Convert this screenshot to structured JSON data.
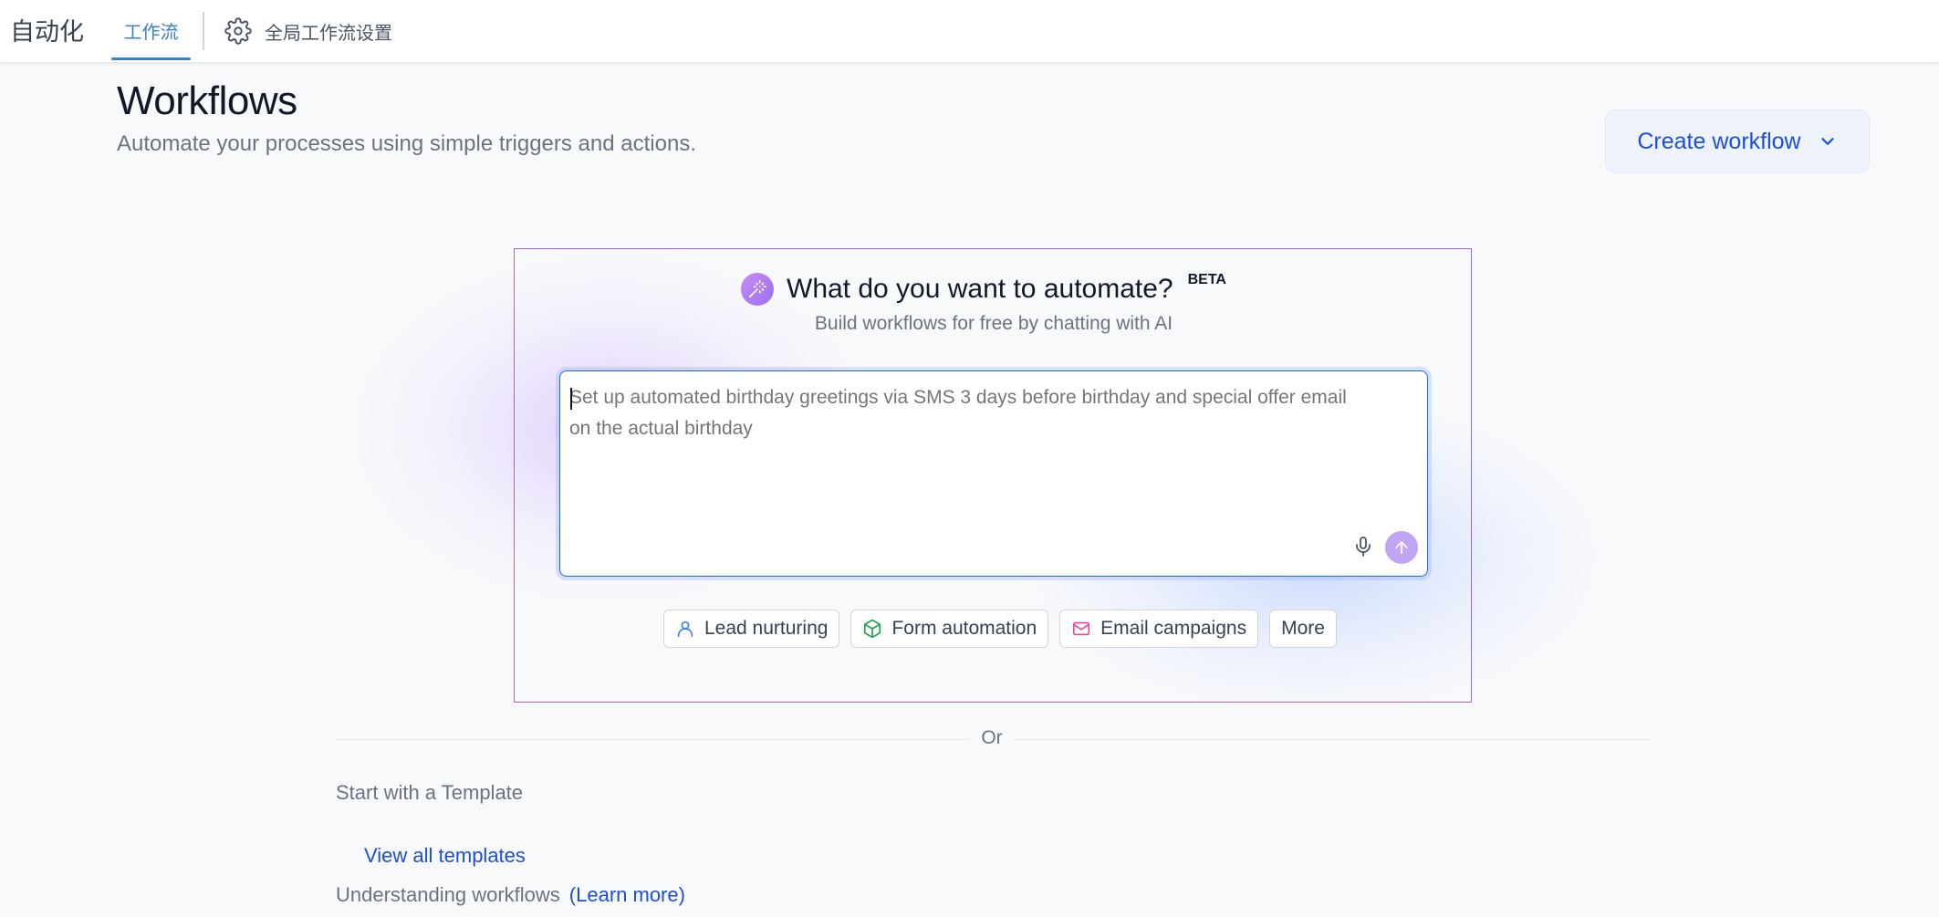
{
  "nav": {
    "app_title": "自动化",
    "tabs": [
      {
        "label": "工作流",
        "active": true
      },
      {
        "label": "全局工作流设置",
        "icon": "gear-icon"
      }
    ]
  },
  "header": {
    "title": "Workflows",
    "subtitle": "Automate your processes using simple triggers and actions.",
    "create_button": "Create workflow"
  },
  "ai": {
    "title": "What do you want to automate?",
    "badge": "BETA",
    "subtitle": "Build workflows for free by chatting with AI",
    "prompt_placeholder": "Set up automated birthday greetings via SMS 3 days before birthday and special offer email on the actual birthday",
    "chips": [
      {
        "label": "Lead nurturing",
        "icon": "user-icon",
        "color": "#3b82f6"
      },
      {
        "label": "Form automation",
        "icon": "cube-icon",
        "color": "#16a34a"
      },
      {
        "label": "Email campaigns",
        "icon": "mail-icon",
        "color": "#ec4899"
      },
      {
        "label": "More"
      }
    ]
  },
  "divider": {
    "label": "Or"
  },
  "templates": {
    "heading": "Start with a Template",
    "view_all": "View all templates"
  },
  "understanding": {
    "label": "Understanding workflows",
    "learn_more": "(Learn more)"
  },
  "colors": {
    "accent": "#1d4ed8",
    "ai_border": "#9f67f0",
    "tab_active": "#3b82c4"
  }
}
